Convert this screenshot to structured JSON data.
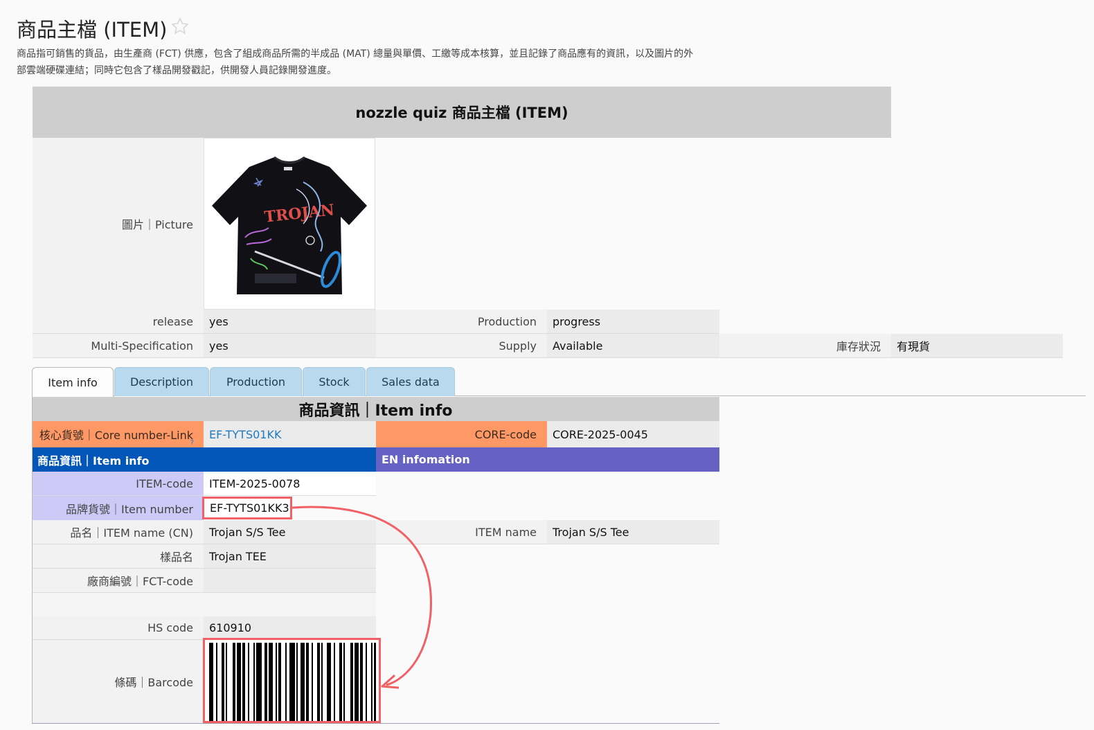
{
  "header": {
    "title": "商品主檔 (ITEM)",
    "description": "商品指可銷售的貨品，由生產商 (FCT) 供應，包含了組成商品所需的半成品 (MAT) 總量與單價、工繳等成本核算，並且記錄了商品應有的資訊，以及圖片的外部雲端硬碟連結；同時它包含了樣品開發戳記，供開發人員記錄開發進度。"
  },
  "record": {
    "banner": "nozzle quiz 商品主檔 (ITEM)",
    "picture_label": "圖片｜Picture",
    "release_label": "release",
    "release_value": "yes",
    "production_label": "Production",
    "production_value": "progress",
    "multispec_label": "Multi-Specification",
    "multispec_value": "yes",
    "supply_label": "Supply",
    "supply_value": "Available",
    "stock_label": "庫存狀況",
    "stock_value": "有現貨"
  },
  "tabs": [
    {
      "label": "Item info"
    },
    {
      "label": "Description"
    },
    {
      "label": "Production"
    },
    {
      "label": "Stock"
    },
    {
      "label": "Sales data"
    }
  ],
  "item_info": {
    "section_title": "商品資訊｜Item info",
    "core_link_label": "核心貨號｜Core number-Link",
    "core_link_help": "?",
    "core_link_value": "EF-TYTS01KK",
    "core_code_label": "CORE-code",
    "core_code_value": "CORE-2025-0045",
    "band_left": "商品資訊｜Item info",
    "band_right": "EN infomation",
    "item_code_label": "ITEM-code",
    "item_code_value": "ITEM-2025-0078",
    "item_number_label": "品牌貨號｜Item number",
    "item_number_value": "EF-TYTS01KK3",
    "name_cn_label": "品名｜ITEM name (CN)",
    "name_cn_value": "Trojan S/S Tee",
    "name_en_label": "ITEM name",
    "name_en_value": "Trojan S/S Tee",
    "sample_name_label": "樣品名",
    "sample_name_value": "Trojan TEE",
    "fct_code_label": "廠商編號｜FCT-code",
    "fct_code_value": "",
    "hs_code_label": "HS code",
    "hs_code_value": "610910",
    "barcode_label": "條碼｜Barcode"
  },
  "colors": {
    "orange": "#fe9966",
    "blue": "#0156b8",
    "purple": "#6562c4",
    "lavender": "#cdcaf7",
    "highlight": "#f06064",
    "tab": "#b9d9ef"
  }
}
